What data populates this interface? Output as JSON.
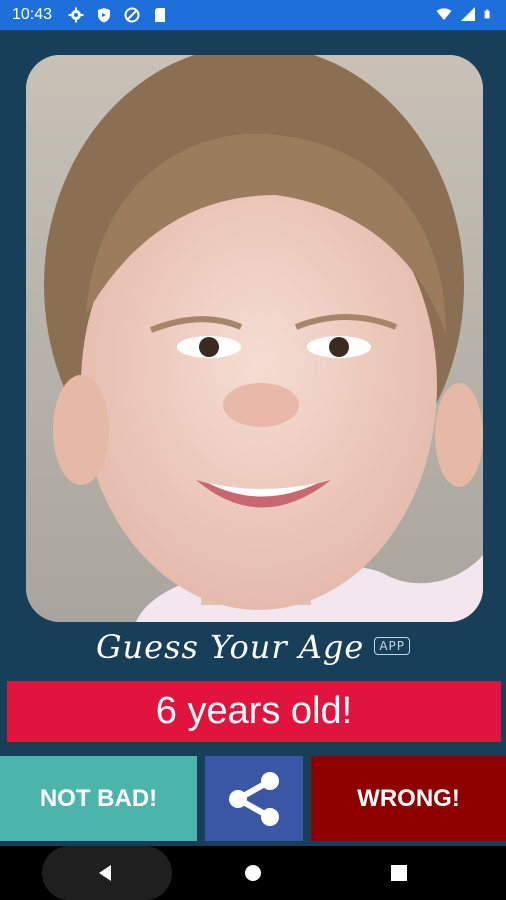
{
  "status_bar": {
    "time": "10:43",
    "left_icons": [
      "gear-icon",
      "shield-icon",
      "no-signal-icon",
      "sd-card-icon"
    ],
    "right_icons": [
      "wifi-icon",
      "battery-icon"
    ]
  },
  "photo": {
    "description_icon": "portrait-photo"
  },
  "title": {
    "text": "Guess Your Age",
    "badge": "APP"
  },
  "result": {
    "text": "6 years old!"
  },
  "buttons": {
    "not_bad": "NOT BAD!",
    "share_icon": "share-icon",
    "wrong": "WRONG!"
  },
  "colors": {
    "background": "#173f5a",
    "status_bar": "#1e6fd9",
    "result": "#e0143c",
    "not_bad": "#4cb5ab",
    "share": "#3a57a5",
    "wrong": "#8e0000"
  }
}
